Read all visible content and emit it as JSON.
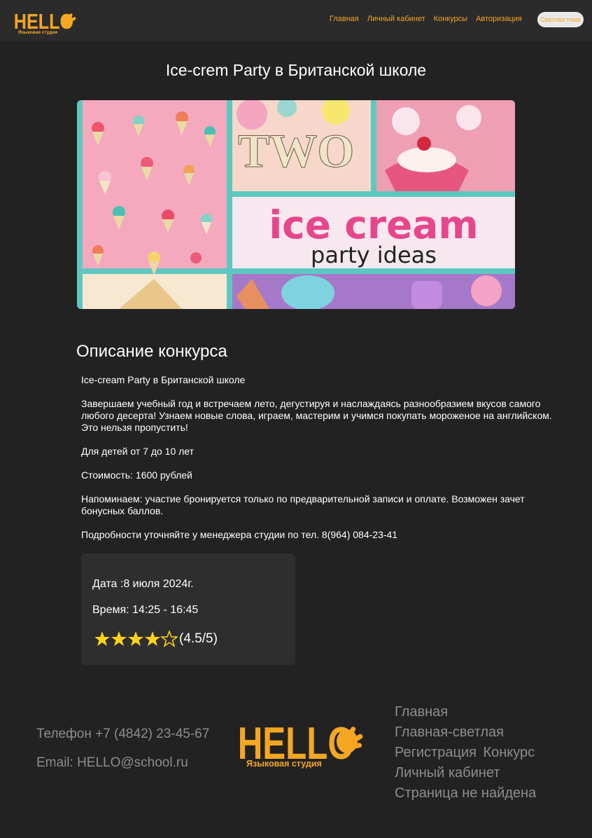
{
  "header": {
    "logo_text": "HELLO",
    "logo_subtitle": "Языковая студия",
    "nav": [
      {
        "label": "Главная"
      },
      {
        "label": "Личный кабинет"
      },
      {
        "label": "Конкурсы"
      },
      {
        "label": "Авторизация"
      }
    ],
    "theme_button": "Светлая тема"
  },
  "page": {
    "title": "Ice-crem Party в Британской школе"
  },
  "banner": {
    "line1": "ice cream",
    "line2": "party ideas",
    "word": "TWO"
  },
  "description": {
    "heading": "Описание конкурса",
    "paragraphs": [
      "Ice-cream Party в Британской школе",
      "Завершаем учебный год и встречаем лето, дегустируя и наслаждаясь разнообразием вкусов самого любого десерта! Узнаем новые слова, играем, мастерим и учимся покупать мороженое на английском. Это нельзя пропустить!",
      "Для детей от 7 до 10 лет",
      "Стоимость: 1600 рублей",
      "Напоминаем: участие бронируется только по предварительной записи и оплате. Возможен зачет бонусных баллов.",
      "Подробности уточняйте у менеджера студии по тел. 8(964) 084-23-41"
    ]
  },
  "info": {
    "date": "Дата :8 июля 2024г.",
    "time": "Время: 14:25 - 16:45",
    "rating_value": 4.5,
    "rating_text": "(4.5/5)"
  },
  "footer": {
    "phone": "Телефон +7 (4842) 23-45-67",
    "email": "Email: HELLO@school.ru",
    "logo_text": "HELLO",
    "logo_subtitle": "Языковая студия",
    "links": {
      "main": "Главная",
      "main_light": "Главная-светлая",
      "registration": "Регистрация",
      "contest": "Конкурс",
      "cabinet": "Личный кабинет",
      "not_found": "Страница не найдена"
    }
  },
  "colors": {
    "accent": "#f5a623",
    "background": "#222222",
    "header": "#2b2b2b",
    "card": "#2e2e2e",
    "footer_text": "#8d8d8d",
    "star": "#ffd21e"
  }
}
